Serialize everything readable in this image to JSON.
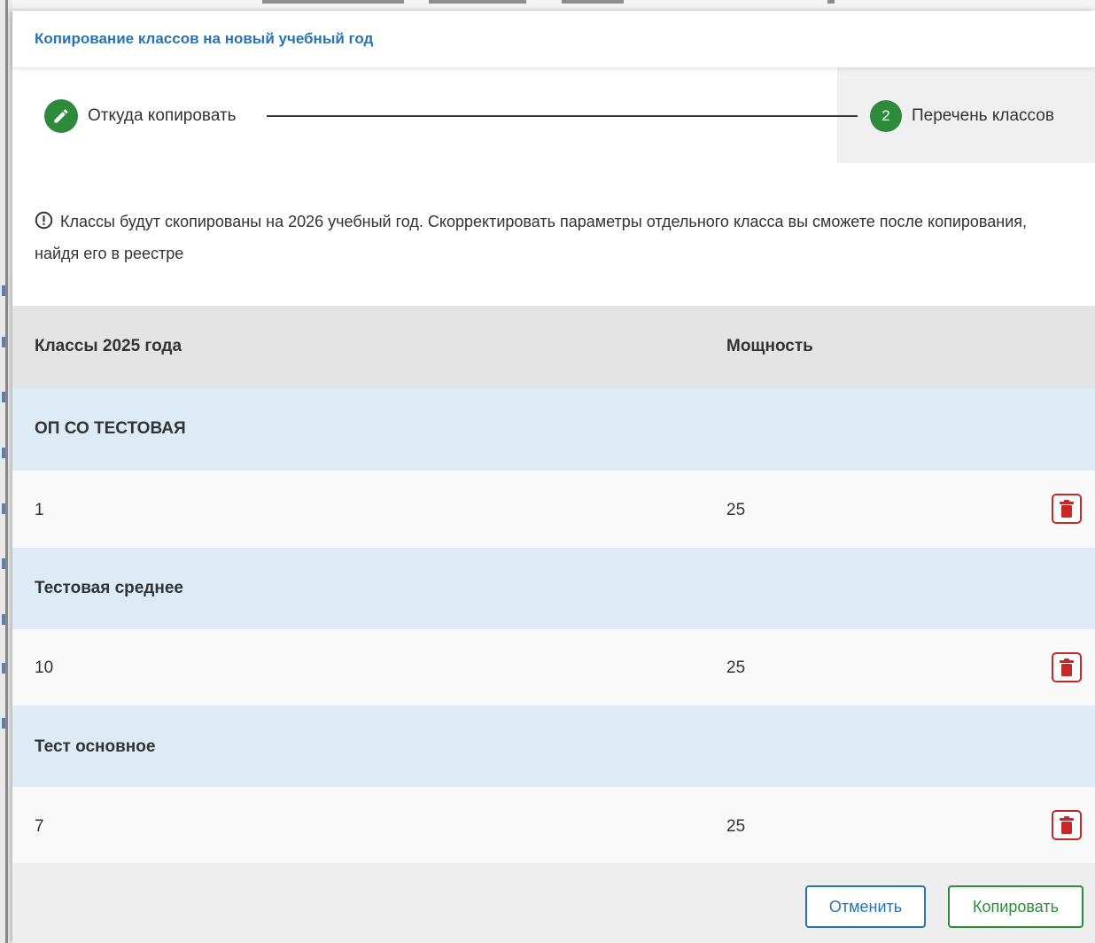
{
  "dialog": {
    "title": "Копирование классов на новый учебный год"
  },
  "stepper": {
    "steps": [
      {
        "label": "Откуда копировать",
        "state": "done",
        "icon": "pencil-icon"
      },
      {
        "label": "Перечень классов",
        "state": "active",
        "number": "2"
      }
    ]
  },
  "info": {
    "icon": "exclamation-circle-icon",
    "text": "Классы будут скопированы на 2026 учебный год. Скорректировать параметры отдельного класса вы сможете после копирования, найдя его в реестре"
  },
  "table": {
    "headers": {
      "classes": "Классы 2025 года",
      "capacity": "Мощность"
    },
    "groups": [
      {
        "name": "ОП СО ТЕСТОВАЯ",
        "rows": [
          {
            "class": "1",
            "capacity": "25"
          }
        ]
      },
      {
        "name": "Тестовая среднее",
        "rows": [
          {
            "class": "10",
            "capacity": "25"
          }
        ]
      },
      {
        "name": "Тест основное",
        "rows": [
          {
            "class": "7",
            "capacity": "25"
          }
        ]
      }
    ],
    "delete_icon": "trash-icon"
  },
  "footer": {
    "cancel_label": "Отменить",
    "copy_label": "Копировать"
  },
  "colors": {
    "accent_blue": "#2a73b2",
    "success_green": "#2e8b3b",
    "danger_red": "#c62828",
    "group_row_bg": "#dcebf5",
    "header_bg": "#e4e4e4"
  }
}
